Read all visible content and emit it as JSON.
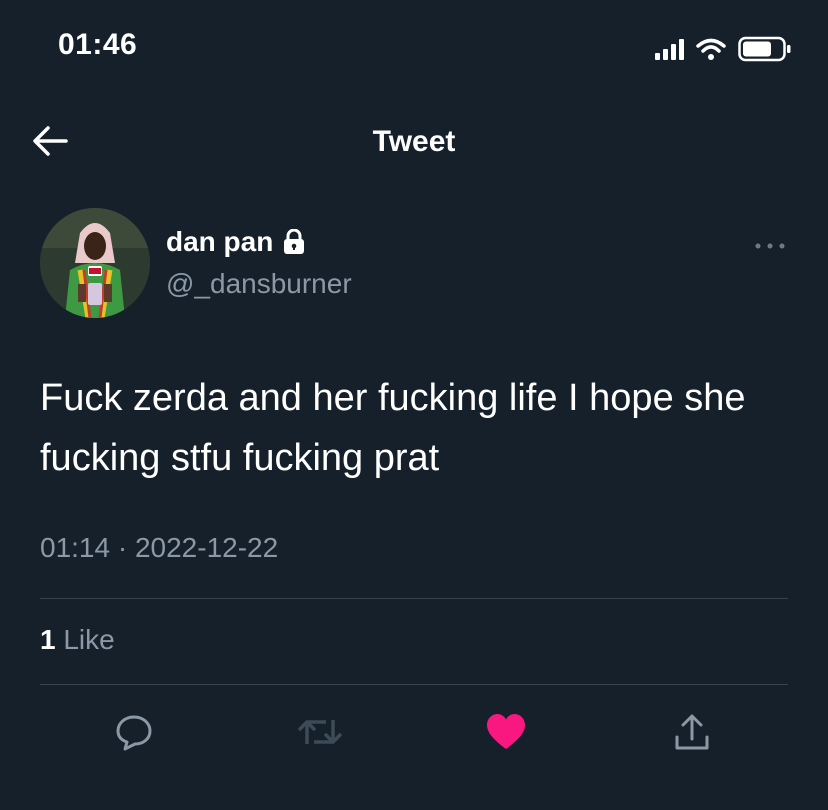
{
  "status_bar": {
    "time": "01:46"
  },
  "nav": {
    "title": "Tweet"
  },
  "tweet": {
    "author": {
      "name": "dan pan",
      "handle": "@_dansburner",
      "protected": true
    },
    "text": "Fuck zerda and her fucking life I hope she fucking stfu fucking prat",
    "time": "01:14",
    "separator": " · ",
    "date": "2022-12-22",
    "likes": {
      "count": "1",
      "label": " Like"
    },
    "liked": true
  },
  "colors": {
    "background": "#15202b",
    "text_secondary": "#8b98a5",
    "like_active": "#f91880",
    "divider": "#38444d"
  },
  "icons": [
    "back-arrow-icon",
    "lock-icon",
    "more-icon",
    "reply-icon",
    "retweet-icon",
    "heart-icon",
    "share-icon",
    "signal-icon",
    "wifi-icon",
    "battery-icon"
  ]
}
